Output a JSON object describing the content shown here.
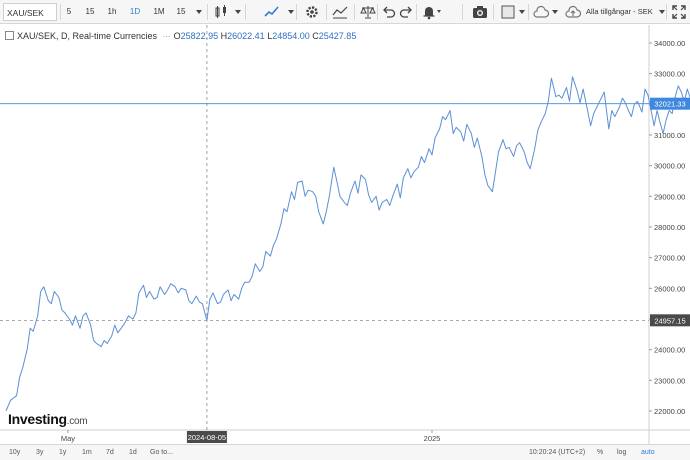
{
  "toolbar": {
    "symbol": "XAU/SEK",
    "intervals": [
      "5",
      "15",
      "1h",
      "1D",
      "1M",
      "15"
    ],
    "active_interval": "1D",
    "currency_selector": "Alla tillgångar - SEK"
  },
  "legend": {
    "name": "XAU/SEK, D, Real-time Currencies",
    "o_label": "O",
    "o": "25822.95",
    "h_label": "H",
    "h": "26022.41",
    "l_label": "L",
    "l": "24854.00",
    "c_label": "C",
    "c": "25427.85"
  },
  "price_badges": {
    "last": "32021.33",
    "crosshair": "24957.15"
  },
  "x_labels": {
    "may": "May",
    "y2025": "2025",
    "crosshair_date": "2024-08-05"
  },
  "logo": {
    "main": "Investing",
    "suffix": ".com"
  },
  "bottombar": {
    "ranges": [
      "10y",
      "3y",
      "1y",
      "1m",
      "7d",
      "1d"
    ],
    "goto": "Go to...",
    "time": "10:20:24 (UTC+2)",
    "percent": "%",
    "log": "log",
    "auto": "auto"
  },
  "colors": {
    "line": "#5b8fd6",
    "last_price": "#3f88dd",
    "crosshair_badge": "#4a4a4a"
  },
  "chart_data": {
    "type": "line",
    "title": "XAU/SEK, D, Real-time Currencies",
    "x_range": [
      "2024-03-25",
      "2025-05-20"
    ],
    "ylim": [
      21500,
      34300
    ],
    "y_ticks": [
      22000,
      23000,
      24000,
      25000,
      26000,
      27000,
      28000,
      29000,
      30000,
      31000,
      32000,
      33000,
      34000
    ],
    "y_tick_labels": [
      "22000.00",
      "23000.00",
      "24000.00",
      "25000.00",
      "26000.00",
      "27000.00",
      "28000.00",
      "29000.00",
      "30000.00",
      "31000.00",
      "32000.00",
      "33000.00",
      "34000.00"
    ],
    "grid": false,
    "series": [
      {
        "values": [
          [
            "2024-03-25",
            22000
          ],
          [
            "2024-03-28",
            22350
          ],
          [
            "2024-04-01",
            22500
          ],
          [
            "2024-04-03",
            23100
          ],
          [
            "2024-04-05",
            23400
          ],
          [
            "2024-04-08",
            24000
          ],
          [
            "2024-04-10",
            24700
          ],
          [
            "2024-04-12",
            24600
          ],
          [
            "2024-04-15",
            25100
          ],
          [
            "2024-04-17",
            25900
          ],
          [
            "2024-04-19",
            26050
          ],
          [
            "2024-04-22",
            25600
          ],
          [
            "2024-04-24",
            25500
          ],
          [
            "2024-04-26",
            25900
          ],
          [
            "2024-04-29",
            25700
          ],
          [
            "2024-05-01",
            25300
          ],
          [
            "2024-05-03",
            25200
          ],
          [
            "2024-05-06",
            25000
          ],
          [
            "2024-05-08",
            24800
          ],
          [
            "2024-05-10",
            25100
          ],
          [
            "2024-05-13",
            24700
          ],
          [
            "2024-05-15",
            25100
          ],
          [
            "2024-05-17",
            25200
          ],
          [
            "2024-05-20",
            24800
          ],
          [
            "2024-05-22",
            24300
          ],
          [
            "2024-05-24",
            24200
          ],
          [
            "2024-05-27",
            24100
          ],
          [
            "2024-05-29",
            24300
          ],
          [
            "2024-05-31",
            24200
          ],
          [
            "2024-06-03",
            24450
          ],
          [
            "2024-06-05",
            24800
          ],
          [
            "2024-06-07",
            24550
          ],
          [
            "2024-06-10",
            24750
          ],
          [
            "2024-06-12",
            24900
          ],
          [
            "2024-06-14",
            25100
          ],
          [
            "2024-06-17",
            25000
          ],
          [
            "2024-06-19",
            25200
          ],
          [
            "2024-06-21",
            25850
          ],
          [
            "2024-06-24",
            26100
          ],
          [
            "2024-06-26",
            25700
          ],
          [
            "2024-06-28",
            25900
          ],
          [
            "2024-07-01",
            25650
          ],
          [
            "2024-07-03",
            25700
          ],
          [
            "2024-07-05",
            26050
          ],
          [
            "2024-07-08",
            25800
          ],
          [
            "2024-07-10",
            25950
          ],
          [
            "2024-07-12",
            26150
          ],
          [
            "2024-07-15",
            26050
          ],
          [
            "2024-07-17",
            25850
          ],
          [
            "2024-07-19",
            26000
          ],
          [
            "2024-07-22",
            25950
          ],
          [
            "2024-07-24",
            25600
          ],
          [
            "2024-07-26",
            25500
          ],
          [
            "2024-07-29",
            25750
          ],
          [
            "2024-07-31",
            25550
          ],
          [
            "2024-08-02",
            25500
          ],
          [
            "2024-08-05",
            24950
          ],
          [
            "2024-08-07",
            25650
          ],
          [
            "2024-08-09",
            25850
          ],
          [
            "2024-08-12",
            25500
          ],
          [
            "2024-08-14",
            25550
          ],
          [
            "2024-08-16",
            25800
          ],
          [
            "2024-08-19",
            25950
          ],
          [
            "2024-08-21",
            25600
          ],
          [
            "2024-08-23",
            25800
          ],
          [
            "2024-08-26",
            25650
          ],
          [
            "2024-08-28",
            26000
          ],
          [
            "2024-08-30",
            26200
          ],
          [
            "2024-09-02",
            26200
          ],
          [
            "2024-09-04",
            26400
          ],
          [
            "2024-09-06",
            26800
          ],
          [
            "2024-09-09",
            26550
          ],
          [
            "2024-09-11",
            26700
          ],
          [
            "2024-09-13",
            27200
          ],
          [
            "2024-09-16",
            27050
          ],
          [
            "2024-09-18",
            27400
          ],
          [
            "2024-09-20",
            27600
          ],
          [
            "2024-09-23",
            28100
          ],
          [
            "2024-09-25",
            28600
          ],
          [
            "2024-09-27",
            28500
          ],
          [
            "2024-09-30",
            29150
          ],
          [
            "2024-10-02",
            28900
          ],
          [
            "2024-10-04",
            29450
          ],
          [
            "2024-10-07",
            29500
          ],
          [
            "2024-10-09",
            29000
          ],
          [
            "2024-10-11",
            29200
          ],
          [
            "2024-10-14",
            29150
          ],
          [
            "2024-10-16",
            29000
          ],
          [
            "2024-10-18",
            28500
          ],
          [
            "2024-10-21",
            28100
          ],
          [
            "2024-10-23",
            28500
          ],
          [
            "2024-10-25",
            29000
          ],
          [
            "2024-10-28",
            29950
          ],
          [
            "2024-10-30",
            29500
          ],
          [
            "2024-11-01",
            29000
          ],
          [
            "2024-11-04",
            28800
          ],
          [
            "2024-11-06",
            28700
          ],
          [
            "2024-11-08",
            29100
          ],
          [
            "2024-11-11",
            29500
          ],
          [
            "2024-11-13",
            29100
          ],
          [
            "2024-11-15",
            29700
          ],
          [
            "2024-11-18",
            29550
          ],
          [
            "2024-11-20",
            29050
          ],
          [
            "2024-11-22",
            28800
          ],
          [
            "2024-11-25",
            29000
          ],
          [
            "2024-11-27",
            28550
          ],
          [
            "2024-11-29",
            28800
          ],
          [
            "2024-12-02",
            28900
          ],
          [
            "2024-12-04",
            28700
          ],
          [
            "2024-12-06",
            29000
          ],
          [
            "2024-12-09",
            29400
          ],
          [
            "2024-12-11",
            28950
          ],
          [
            "2024-12-13",
            29600
          ],
          [
            "2024-12-16",
            29900
          ],
          [
            "2024-12-18",
            29600
          ],
          [
            "2024-12-20",
            29800
          ],
          [
            "2024-12-23",
            29950
          ],
          [
            "2024-12-25",
            30300
          ],
          [
            "2024-12-27",
            30100
          ],
          [
            "2024-12-30",
            30550
          ],
          [
            "2025-01-01",
            30350
          ],
          [
            "2025-01-03",
            30900
          ],
          [
            "2025-01-06",
            31200
          ],
          [
            "2025-01-08",
            31600
          ],
          [
            "2025-01-10",
            31500
          ],
          [
            "2025-01-13",
            31800
          ],
          [
            "2025-01-15",
            31050
          ],
          [
            "2025-01-17",
            31250
          ],
          [
            "2025-01-20",
            31100
          ],
          [
            "2025-01-22",
            30800
          ],
          [
            "2025-01-24",
            31350
          ],
          [
            "2025-01-27",
            31050
          ],
          [
            "2025-01-29",
            30600
          ],
          [
            "2025-01-31",
            30900
          ],
          [
            "2025-02-03",
            30300
          ],
          [
            "2025-02-05",
            29700
          ],
          [
            "2025-02-07",
            29350
          ],
          [
            "2025-02-10",
            29150
          ],
          [
            "2025-02-12",
            29800
          ],
          [
            "2025-02-14",
            30450
          ],
          [
            "2025-02-17",
            30850
          ],
          [
            "2025-02-19",
            30550
          ],
          [
            "2025-02-21",
            30600
          ],
          [
            "2025-02-24",
            30300
          ],
          [
            "2025-02-26",
            30650
          ],
          [
            "2025-02-28",
            30750
          ],
          [
            "2025-03-03",
            30450
          ],
          [
            "2025-03-05",
            30100
          ],
          [
            "2025-03-07",
            29900
          ],
          [
            "2025-03-10",
            30550
          ],
          [
            "2025-03-12",
            31150
          ],
          [
            "2025-03-14",
            31400
          ],
          [
            "2025-03-17",
            31700
          ],
          [
            "2025-03-19",
            32100
          ],
          [
            "2025-03-21",
            32850
          ],
          [
            "2025-03-24",
            32250
          ],
          [
            "2025-03-26",
            32300
          ],
          [
            "2025-03-28",
            32200
          ],
          [
            "2025-03-31",
            32550
          ],
          [
            "2025-04-02",
            32100
          ],
          [
            "2025-04-04",
            32900
          ],
          [
            "2025-04-07",
            32450
          ],
          [
            "2025-04-09",
            32050
          ],
          [
            "2025-04-11",
            32500
          ],
          [
            "2025-04-14",
            31800
          ],
          [
            "2025-04-16",
            31300
          ],
          [
            "2025-04-18",
            31700
          ],
          [
            "2025-04-21",
            32000
          ],
          [
            "2025-04-23",
            32200
          ],
          [
            "2025-04-25",
            32400
          ],
          [
            "2025-04-28",
            31200
          ],
          [
            "2025-04-30",
            31800
          ],
          [
            "2025-05-02",
            31600
          ],
          [
            "2025-05-05",
            31900
          ],
          [
            "2025-05-07",
            32200
          ],
          [
            "2025-05-09",
            32050
          ],
          [
            "2025-05-11",
            31800
          ],
          [
            "2025-05-13",
            31600
          ],
          [
            "2025-05-15",
            32000
          ],
          [
            "2025-05-17",
            32100
          ],
          [
            "2025-05-20",
            31750
          ],
          [
            "2025-05-22",
            32500
          ],
          [
            "2025-05-24",
            32300
          ],
          [
            "2025-05-26",
            31800
          ],
          [
            "2025-05-28",
            31300
          ],
          [
            "2025-05-30",
            31800
          ],
          [
            "2025-06-01",
            31400
          ],
          [
            "2025-06-03",
            31050
          ],
          [
            "2025-06-05",
            31500
          ],
          [
            "2025-06-07",
            31800
          ],
          [
            "2025-06-09",
            31700
          ],
          [
            "2025-06-11",
            32250
          ],
          [
            "2025-06-13",
            32600
          ],
          [
            "2025-06-15",
            32400
          ],
          [
            "2025-06-17",
            32100
          ],
          [
            "2025-06-19",
            32500
          ],
          [
            "2025-06-21",
            32200
          ],
          [
            "2025-06-23",
            32550
          ],
          [
            "2025-06-25",
            32750
          ],
          [
            "2025-06-27",
            32400
          ],
          [
            "2025-06-29",
            32550
          ],
          [
            "2025-07-01",
            32250
          ],
          [
            "2025-07-03",
            32200
          ],
          [
            "2025-07-05",
            32100
          ],
          [
            "2025-07-07",
            32000
          ],
          [
            "2025-07-09",
            32050
          ],
          [
            "2025-07-11",
            32021
          ]
        ]
      }
    ]
  }
}
